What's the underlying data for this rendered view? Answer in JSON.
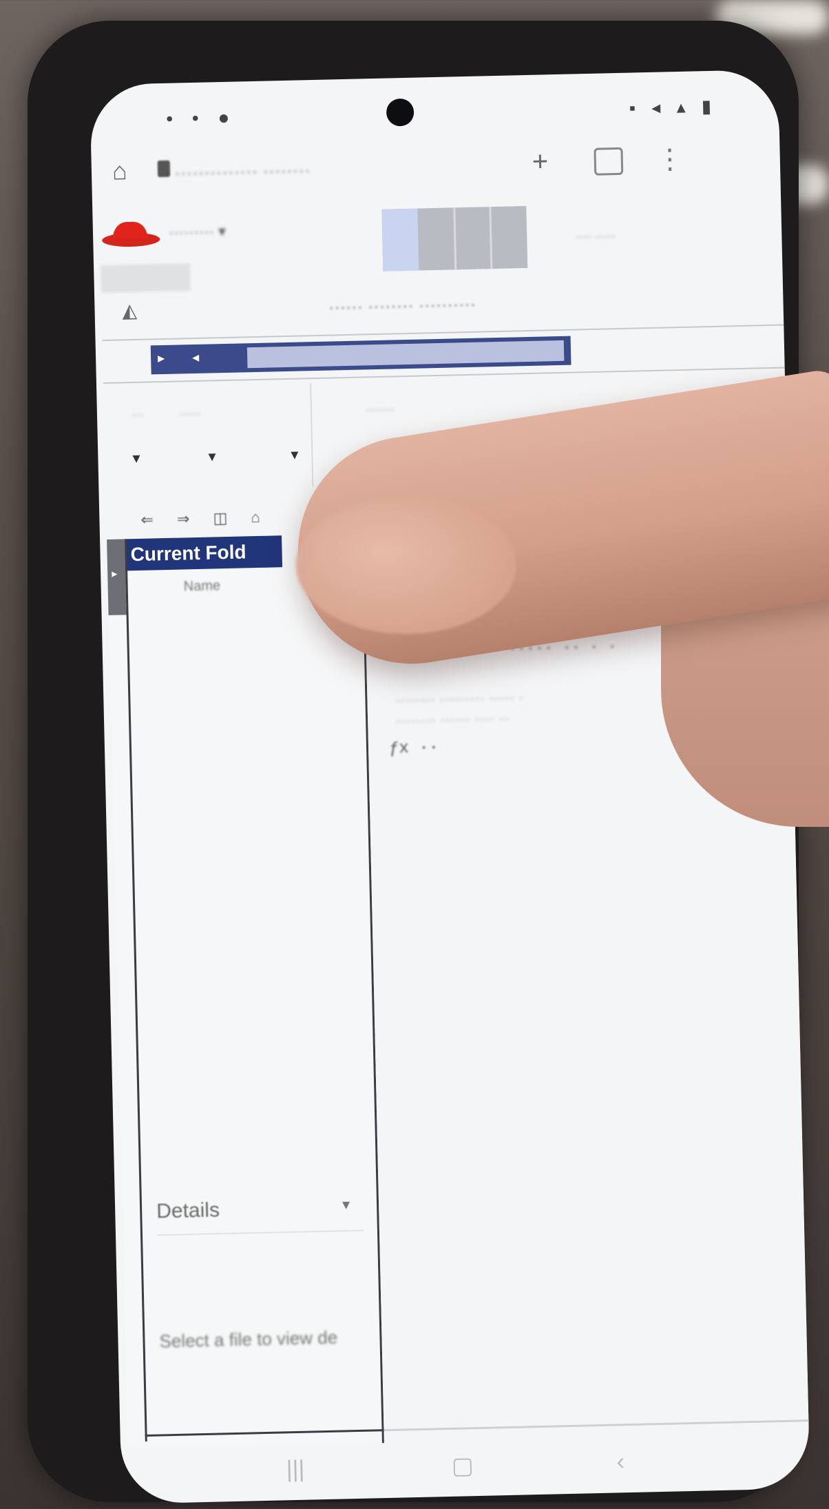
{
  "scene": "phone-held-in-hand",
  "colors": {
    "matlab_blue": "#21357a",
    "screen_bg": "#f4f5f6",
    "phone_body": "#1d1b1b"
  },
  "icons": [
    "home-icon",
    "lock-icon",
    "plus-icon",
    "tabs-icon",
    "more-icon",
    "redhat-logo-icon",
    "matlab-icon",
    "chevron-down-icon"
  ],
  "matlab": {
    "current_folder_label": "Current Fold",
    "folder_column_name": "Name",
    "details_title": "Details",
    "details_message": "Select a file to view de"
  }
}
